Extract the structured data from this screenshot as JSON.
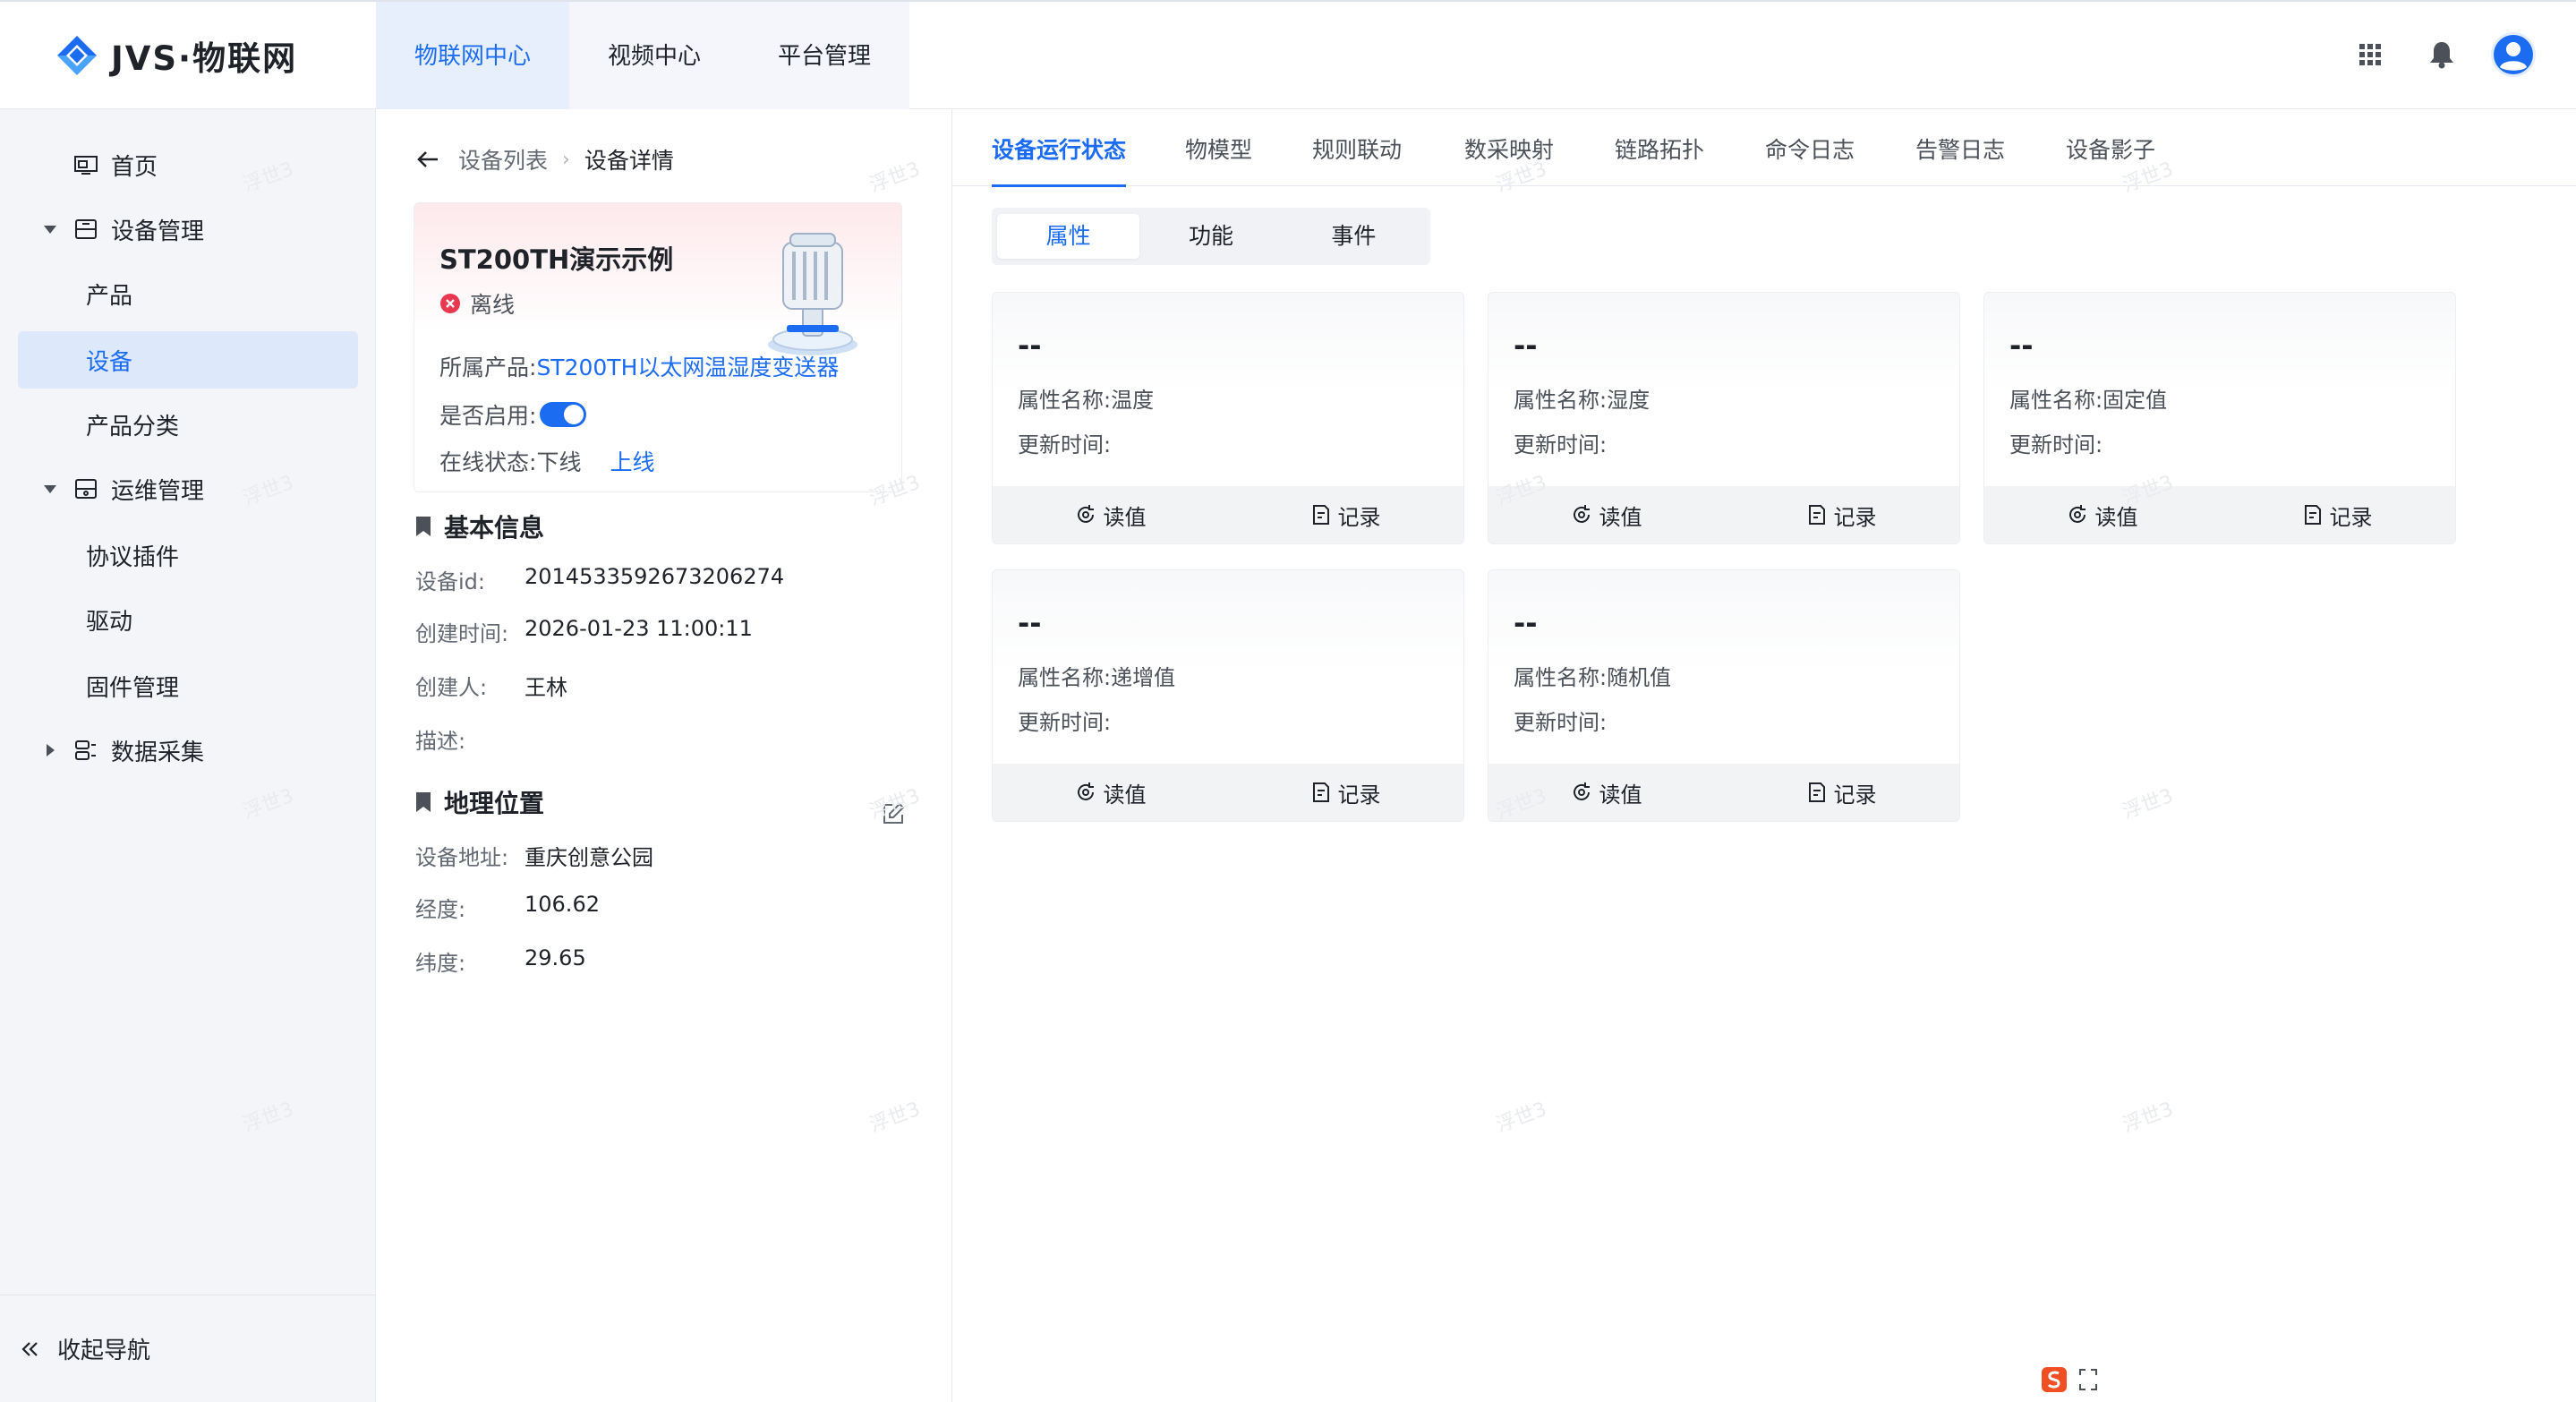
{
  "app": {
    "logo_text": "JVS·物联网",
    "brand_color": "#1c6cf2"
  },
  "topnav": {
    "items": [
      {
        "label": "物联网中心",
        "active": true
      },
      {
        "label": "视频中心",
        "active": false
      },
      {
        "label": "平台管理",
        "active": false
      }
    ],
    "icons": [
      "apps-grid-icon",
      "bell-icon",
      "user-avatar-icon"
    ]
  },
  "sidebar": {
    "items": [
      {
        "label": "首页",
        "level": 1,
        "icon": "home-icon"
      },
      {
        "label": "设备管理",
        "level": 1,
        "icon": "device-icon",
        "expanded": true
      },
      {
        "label": "产品",
        "level": 2
      },
      {
        "label": "设备",
        "level": 2,
        "active": true
      },
      {
        "label": "产品分类",
        "level": 2
      },
      {
        "label": "运维管理",
        "level": 1,
        "icon": "ops-icon",
        "expanded": true
      },
      {
        "label": "协议插件",
        "level": 2
      },
      {
        "label": "驱动",
        "level": 2
      },
      {
        "label": "固件管理",
        "level": 2
      },
      {
        "label": "数据采集",
        "level": 1,
        "icon": "collect-icon",
        "expanded": false
      }
    ],
    "collapse_label": "收起导航"
  },
  "breadcrumb": {
    "list": "设备列表",
    "current": "设备详情"
  },
  "device": {
    "name": "ST200TH演示示例",
    "status": "离线",
    "status_color": "#e8384f",
    "product_label": "所属产品:",
    "product_value": "ST200TH以太网温湿度变送器",
    "enabled_label": "是否启用:",
    "enabled": true,
    "online_label": "在线状态:",
    "online_off": "下线",
    "online_on": "上线"
  },
  "basic_info": {
    "title": "基本信息",
    "rows": [
      {
        "k": "设备id:",
        "v": "2014533592673206274"
      },
      {
        "k": "创建时间:",
        "v": "2026-01-23 11:00:11"
      },
      {
        "k": "创建人:",
        "v": "王林"
      },
      {
        "k": "描述:",
        "v": ""
      }
    ]
  },
  "location": {
    "title": "地理位置",
    "rows": [
      {
        "k": "设备地址:",
        "v": "重庆创意公园"
      },
      {
        "k": "经度:",
        "v": "106.62"
      },
      {
        "k": "纬度:",
        "v": "29.65"
      }
    ]
  },
  "tabs": [
    {
      "label": "设备运行状态",
      "active": true
    },
    {
      "label": "物模型"
    },
    {
      "label": "规则联动"
    },
    {
      "label": "数采映射"
    },
    {
      "label": "链路拓扑"
    },
    {
      "label": "命令日志"
    },
    {
      "label": "告警日志"
    },
    {
      "label": "设备影子"
    }
  ],
  "segment": [
    {
      "label": "属性",
      "active": true
    },
    {
      "label": "功能"
    },
    {
      "label": "事件"
    }
  ],
  "properties": [
    {
      "value": "--",
      "name": "属性名称:温度",
      "time": "更新时间:"
    },
    {
      "value": "--",
      "name": "属性名称:湿度",
      "time": "更新时间:"
    },
    {
      "value": "--",
      "name": "属性名称:固定值",
      "time": "更新时间:"
    },
    {
      "value": "--",
      "name": "属性名称:递增值",
      "time": "更新时间:"
    },
    {
      "value": "--",
      "name": "属性名称:随机值",
      "time": "更新时间:"
    }
  ],
  "card_actions": {
    "read": "读值",
    "record": "记录"
  },
  "watermark": "浮世3"
}
